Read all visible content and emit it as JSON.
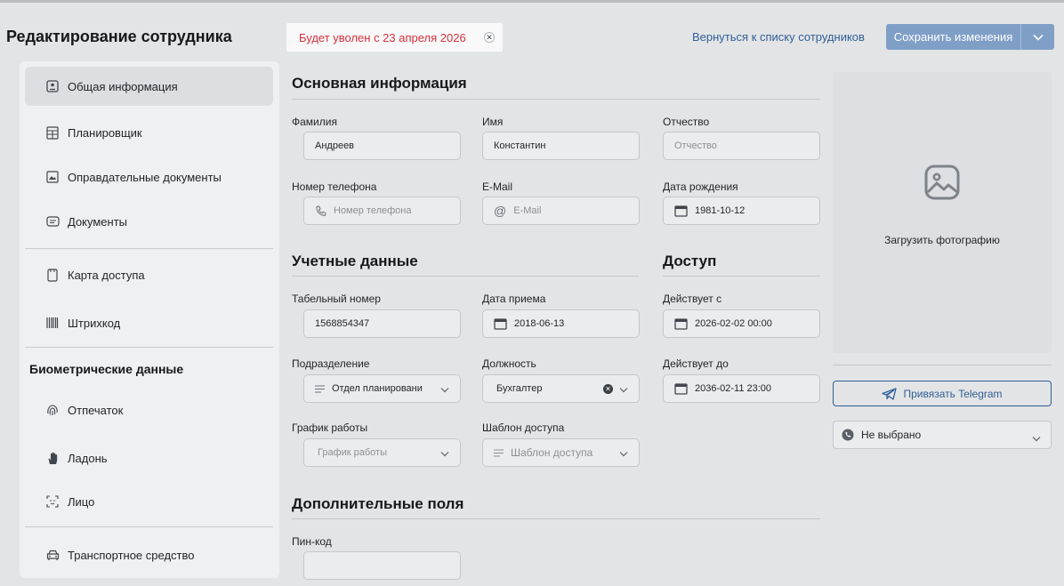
{
  "header": {
    "title": "Редактирование сотрудника",
    "dismissal_notice": "Будет уволен с 23 апреля 2026",
    "back_link": "Вернуться к списку сотрудников",
    "save_label": "Сохранить изменения"
  },
  "sidebar": {
    "items": [
      {
        "label": "Общая информация",
        "icon": "profile-card-icon",
        "active": true
      },
      {
        "label": "Планировщик",
        "icon": "calendar-grid-icon"
      },
      {
        "label": "Оправдательные документы",
        "icon": "document-image-icon"
      },
      {
        "label": "Документы",
        "icon": "id-card-icon"
      },
      {
        "label": "Карта доступа",
        "icon": "access-card-icon"
      },
      {
        "label": "Штрихкод",
        "icon": "barcode-icon"
      },
      {
        "label": "Отпечаток",
        "icon": "fingerprint-icon"
      },
      {
        "label": "Ладонь",
        "icon": "palm-icon"
      },
      {
        "label": "Лицо",
        "icon": "face-scan-icon"
      },
      {
        "label": "Транспортное средство",
        "icon": "car-icon"
      }
    ],
    "biometric_heading": "Биометрические данные"
  },
  "basic": {
    "title": "Основная информация",
    "last_name": {
      "label": "Фамилия",
      "value": "Андреев"
    },
    "first_name": {
      "label": "Имя",
      "value": "Константин"
    },
    "patronymic": {
      "label": "Отчество",
      "placeholder": "Отчество"
    },
    "phone": {
      "label": "Номер телефона",
      "placeholder": "Номер телефона"
    },
    "email": {
      "label": "E-Mail",
      "placeholder": "E-Mail"
    },
    "birth_date": {
      "label": "Дата рождения",
      "value": "1981-10-12"
    }
  },
  "account": {
    "title": "Учетные данные",
    "personnel_number": {
      "label": "Табельный номер",
      "value": "1568854347"
    },
    "hire_date": {
      "label": "Дата приема",
      "value": "2018-06-13"
    },
    "department": {
      "label": "Подразделение",
      "value": "Отдел планировани"
    },
    "position": {
      "label": "Должность",
      "value": "Бухгалтер"
    },
    "schedule": {
      "label": "График работы",
      "placeholder": "График работы"
    },
    "access_template": {
      "label": "Шаблон доступа",
      "placeholder": "Шаблон доступа"
    }
  },
  "access": {
    "title": "Доступ",
    "valid_from": {
      "label": "Действует с",
      "value": "2026-02-02 00:00"
    },
    "valid_to": {
      "label": "Действует до",
      "value": "2036-02-11 23:00"
    }
  },
  "extra": {
    "title": "Дополнительные поля",
    "pin": {
      "label": "Пин-код",
      "value": ""
    }
  },
  "right": {
    "upload_photo": "Загрузить фотографию",
    "telegram": "Привязать Telegram",
    "viber": "Не выбрано"
  },
  "colors": {
    "accent": "#2f5f97",
    "save_button": "#7f9fc7",
    "danger_text": "#d6303a"
  }
}
